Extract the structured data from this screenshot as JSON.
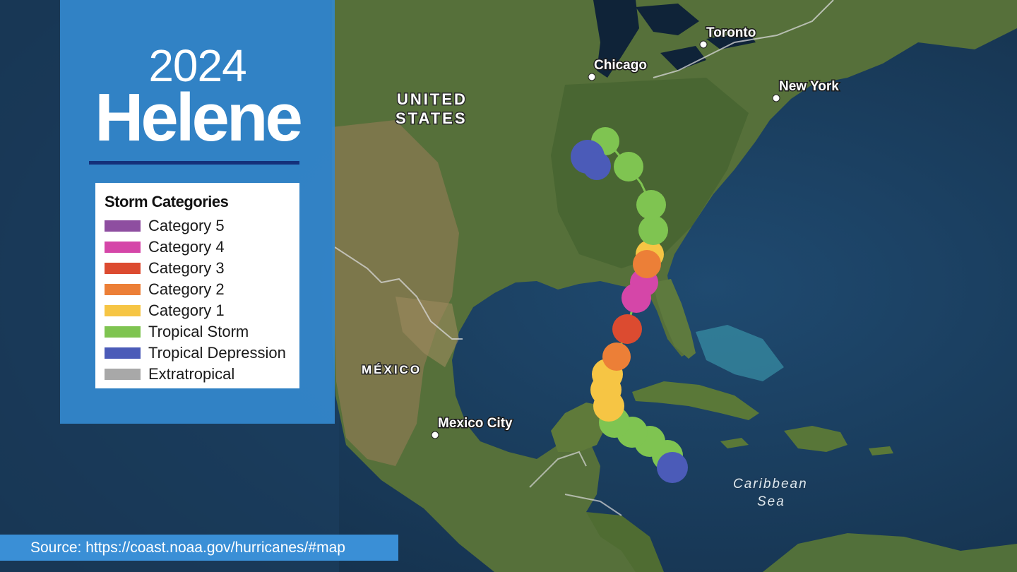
{
  "storm": {
    "year": "2024",
    "name": "Helene"
  },
  "legend": {
    "title": "Storm Categories",
    "items": [
      {
        "label": "Category 5",
        "color": "#8e4ea0"
      },
      {
        "label": "Category 4",
        "color": "#d546a8"
      },
      {
        "label": "Category 3",
        "color": "#dc4b30"
      },
      {
        "label": "Category 2",
        "color": "#ec7f37"
      },
      {
        "label": "Category 1",
        "color": "#f6c544"
      },
      {
        "label": "Tropical Storm",
        "color": "#7fc451"
      },
      {
        "label": "Tropical Depression",
        "color": "#4b5bb8"
      },
      {
        "label": "Extratropical",
        "color": "#a8a8a8"
      }
    ]
  },
  "map_labels": {
    "cities": [
      "Toronto",
      "Chicago",
      "New York",
      "Mexico City"
    ],
    "regions": {
      "usa_line1": "UNITED",
      "usa_line2": "STATES",
      "mexico": "MÉXICO"
    },
    "sea": {
      "line1": "Caribbean",
      "line2": "Sea"
    }
  },
  "source": "Source: https://coast.noaa.gov/hurricanes/#map"
}
